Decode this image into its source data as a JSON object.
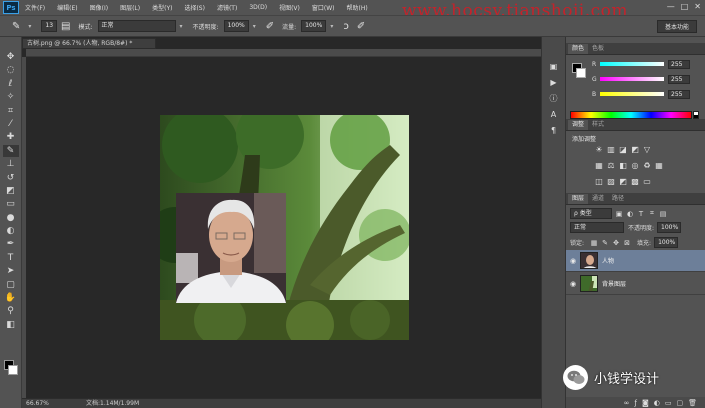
{
  "app": {
    "logo_text": "Ps"
  },
  "menu": {
    "items": [
      "文件(F)",
      "编辑(E)",
      "图像(I)",
      "图层(L)",
      "类型(Y)",
      "选择(S)",
      "滤镜(T)",
      "3D(D)",
      "视图(V)",
      "窗口(W)",
      "帮助(H)"
    ]
  },
  "watermark": {
    "text": "www.hocsy.tianshoji.com",
    "color": "#c3232b"
  },
  "window_controls": {
    "minimize": "—",
    "restore": "□",
    "close": "✕"
  },
  "options": {
    "brush_size": "13",
    "mode_label": "模式:",
    "mode_value": "正常",
    "opacity_label": "不透明度:",
    "opacity_value": "100%",
    "flow_label": "流量:",
    "flow_value": "100%",
    "workspace": "基本功能"
  },
  "document": {
    "tab_title": "古树.png @ 66.7% (人物, RGB/8#) *",
    "zoom": "66.67%",
    "doc_size": "文档:1.14M/1.99M"
  },
  "color_panel": {
    "tabs": [
      "颜色",
      "色板"
    ],
    "channels": [
      {
        "name": "R",
        "value": "255"
      },
      {
        "name": "G",
        "value": "255"
      },
      {
        "name": "B",
        "value": "255"
      }
    ]
  },
  "adjustments_panel": {
    "tabs": [
      "调整",
      "样式"
    ],
    "title": "添加调整"
  },
  "layers_panel": {
    "tabs": [
      "图层",
      "通道",
      "路径"
    ],
    "filter_kind": "ρ 类型",
    "blend_mode": "正常",
    "opacity_label": "不透明度:",
    "opacity_value": "100%",
    "lock_label": "锁定:",
    "fill_label": "填充:",
    "fill_value": "100%",
    "layers": [
      {
        "name": "人物",
        "visible": true,
        "selected": true
      },
      {
        "name": "背景图层",
        "visible": true,
        "selected": false
      }
    ]
  },
  "brand": {
    "text": "小钱学设计"
  },
  "colors": {
    "ui_panel": "#535353",
    "canvas_bg": "#282828",
    "selected_layer": "#6d7f99"
  }
}
